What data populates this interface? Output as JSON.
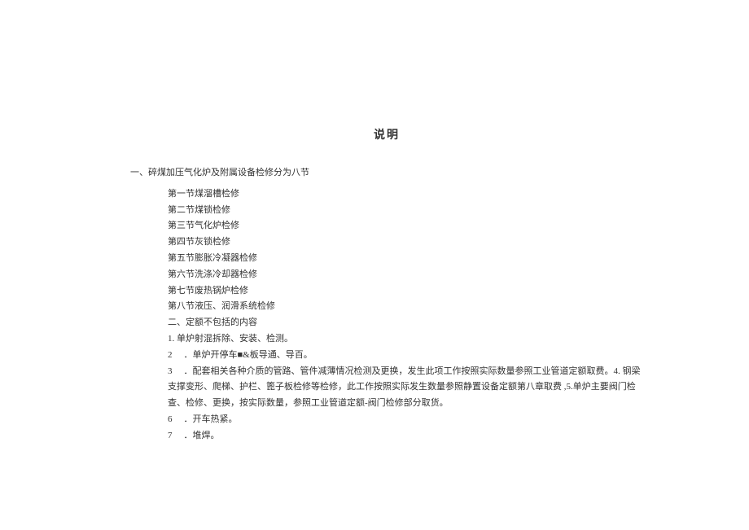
{
  "title": "说明",
  "heading": "一、碎煤加压气化炉及附属设备检修分为八节",
  "sections": [
    "第一节煤溜槽检修",
    "第二节煤锁检修",
    "第三节气化炉检修",
    "第四节灰锁检修",
    "第五节膨胀冷凝器检修",
    "第六节洗涤冷却器检修",
    "第七节废热锅炉检修",
    "第八节液压、润滑系统检修"
  ],
  "sub_heading": "二、定额不包括的内容",
  "item1": "1. 单炉射混拆除、安装、检测。",
  "item2_num": "2",
  "item2_text": "．单炉开停车■&板导通、导百。",
  "item3_num": "3",
  "item3_text": "．配套相关各种介质的管路、管件减薄情况检测及更换，发生此项工作按照实际数量参照工业管道定额取费。4.  钢梁支撑变形、爬梯、护栏、篦子板检修等检修，此工作按照实际发生数量参照静置设备定额第八章取费 ,5.单炉主要阀门检查、检修、更换，按实际数量，参照工业管道定额-阀门检修部分取货。",
  "item6_num": "6",
  "item6_text": "．开车热紧。",
  "item7_num": "7",
  "item7_text": "．堆焊。"
}
